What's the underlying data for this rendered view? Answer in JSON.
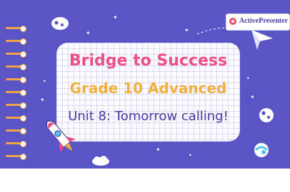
{
  "slide": {
    "title": "Bridge to Success",
    "subtitle": "Grade 10 Advanced",
    "unit": "Unit 8: Tomorrow calling!"
  },
  "badge": {
    "label": "ActivePresenter"
  },
  "colors": {
    "background": "#5a55c6",
    "title": "#ef4f86",
    "subtitle": "#f2b03c",
    "unit": "#4b3aa5",
    "rings": "#f4a447"
  }
}
